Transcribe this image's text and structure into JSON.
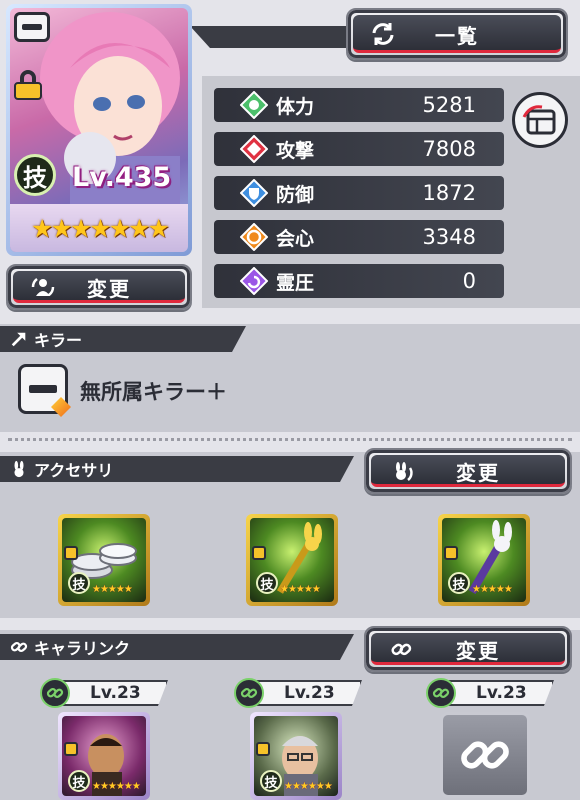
{
  "header": {
    "list_button_label": "一覧"
  },
  "character": {
    "level_label": "Lv.435",
    "skill_badge": "技",
    "change_button_label": "変更",
    "star_glyphs": "★★★★★★★"
  },
  "stats": [
    {
      "name": "体力",
      "value": "5281",
      "icon": "hp-icon",
      "color": "#4cc06b"
    },
    {
      "name": "攻撃",
      "value": "7808",
      "icon": "attack-icon",
      "color": "#e03242"
    },
    {
      "name": "防御",
      "value": "1872",
      "icon": "defense-icon",
      "color": "#3f8fe0"
    },
    {
      "name": "会心",
      "value": "3348",
      "icon": "critical-icon",
      "color": "#f08a1c"
    },
    {
      "name": "霊圧",
      "value": "0",
      "icon": "spirit-icon",
      "color": "#9b56e6"
    }
  ],
  "killer": {
    "section_title": "キラー",
    "item_label": "無所属キラー＋"
  },
  "accessory": {
    "section_title": "アクセサリ",
    "change_button_label": "変更",
    "items": [
      {
        "name": "coin-stack-accessory",
        "badge": "技",
        "stars": "★★★★★"
      },
      {
        "name": "rabbit-wand-gold-accessory",
        "badge": "技",
        "stars": "★★★★★"
      },
      {
        "name": "rabbit-wand-purple-accessory",
        "badge": "技",
        "stars": "★★★★★"
      }
    ]
  },
  "chara_link": {
    "section_title": "キャラリンク",
    "change_button_label": "変更",
    "slots": [
      {
        "level": "Lv.23",
        "badge": "技",
        "stars": "★★★★★★"
      },
      {
        "level": "Lv.23",
        "badge": "技",
        "stars": "★★★★★★"
      },
      {
        "level": "Lv.23"
      }
    ]
  }
}
